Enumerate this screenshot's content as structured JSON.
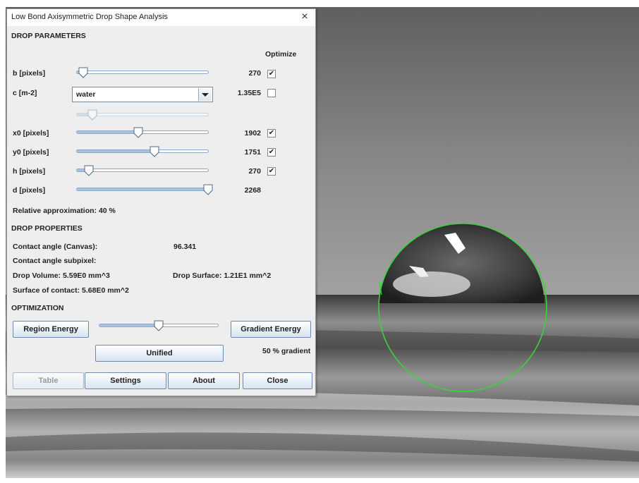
{
  "window": {
    "title": "Low Bond Axisymmetric Drop Shape Analysis",
    "close_glyph": "×"
  },
  "drop_parameters": {
    "heading": "DROP PARAMETERS",
    "optimize_header": "Optimize",
    "rows": [
      {
        "key": "b",
        "label": "b [pixels]",
        "value": "270",
        "slider_fraction": 0.05,
        "optimize": true
      },
      {
        "key": "c",
        "label": "c [m-2]",
        "value": "1.35E5",
        "combo_value": "water",
        "slider_fraction": 0.12,
        "optimize": false
      },
      {
        "key": "x0",
        "label": "x0 [pixels]",
        "value": "1902",
        "slider_fraction": 0.47,
        "optimize": true
      },
      {
        "key": "y0",
        "label": "y0 [pixels]",
        "value": "1751",
        "slider_fraction": 0.59,
        "optimize": true
      },
      {
        "key": "h",
        "label": "h [pixels]",
        "value": "270",
        "slider_fraction": 0.09,
        "optimize": true
      },
      {
        "key": "d",
        "label": "d [pixels]",
        "value": "2268",
        "slider_fraction": 1.0
      }
    ],
    "relative_approximation": "Relative approximation: 40 %"
  },
  "drop_properties": {
    "heading": "DROP PROPERTIES",
    "contact_angle_canvas_label": "Contact angle (Canvas):",
    "contact_angle_canvas_value": "96.341",
    "contact_angle_subpixel_label": "Contact angle subpixel:",
    "drop_volume": "Drop Volume: 5.59E0 mm^3",
    "drop_surface": "Drop Surface: 1.21E1 mm^2",
    "surface_of_contact": "Surface of contact: 5.68E0 mm^2"
  },
  "optimization": {
    "heading": "OPTIMIZATION",
    "region_energy_label": "Region Energy",
    "gradient_energy_label": "Gradient Energy",
    "slider_fraction": 0.5,
    "unified_label": "Unified",
    "gradient_percent": "50 % gradient"
  },
  "footer": {
    "table_label": "Table",
    "settings_label": "Settings",
    "about_label": "About",
    "close_label": "Close"
  },
  "colors": {
    "fit_circle": "#3ad23a",
    "slider_fill": "#a7c2e0",
    "button_border": "#6d8aa9"
  },
  "icons": {
    "checkbox_check": "✔"
  }
}
